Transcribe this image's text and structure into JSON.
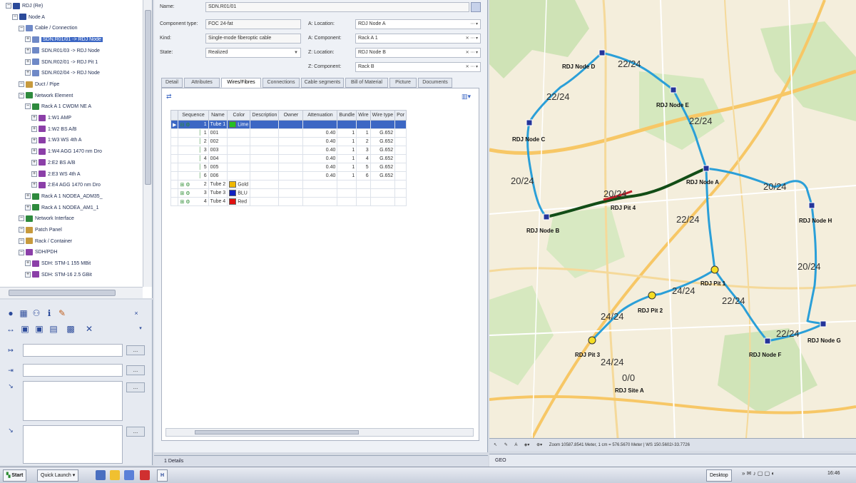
{
  "tree": {
    "items": [
      {
        "label": "RDJ (Re)",
        "icon": "house-icon"
      },
      {
        "label": "Node A",
        "icon": "house-icon"
      },
      {
        "label": "Cable / Connection",
        "icon": "cable-icon"
      },
      {
        "label": "SDN.R01/01 -> RDJ Node",
        "icon": "cable-icon"
      },
      {
        "label": "SDN.R01/03 -> RDJ Node",
        "icon": "cable-icon"
      },
      {
        "label": "SDN.R02/01 -> RDJ Pit 1",
        "icon": "cable-icon"
      },
      {
        "label": "SDN.R02/04 -> RDJ Node",
        "icon": "cable-icon"
      },
      {
        "label": "Duct / Pipe",
        "icon": "duct-icon"
      },
      {
        "label": "Network Element",
        "icon": "element-icon"
      },
      {
        "label": "Rack A 1 CWDM NE A",
        "icon": "element-icon"
      },
      {
        "label": "1:W1 AMP",
        "icon": "port-icon"
      },
      {
        "label": "1:W2 BS A/B",
        "icon": "port-icon"
      },
      {
        "label": "1:W3 WS 4th A",
        "icon": "port-icon"
      },
      {
        "label": "1:W4 AGG 1470 nm Dro",
        "icon": "port-icon"
      },
      {
        "label": "2:E2 BS A/B",
        "icon": "port-icon"
      },
      {
        "label": "2:E3 WS 4th A",
        "icon": "port-icon"
      },
      {
        "label": "2:E4 AGG 1470 nm Dro",
        "icon": "port-icon"
      },
      {
        "label": "Rack A 1 NODEA_ADM35_",
        "icon": "element-icon"
      },
      {
        "label": "Rack A 1 NODEA_AM1_1",
        "icon": "element-icon"
      },
      {
        "label": "Network Interface",
        "icon": "element-icon"
      },
      {
        "label": "Patch Panel",
        "icon": "folder-icon"
      },
      {
        "label": "Rack / Container",
        "icon": "folder-icon"
      },
      {
        "label": "SDH/PDH",
        "icon": "port-icon"
      },
      {
        "label": "SDH: STM-1 155 MBit",
        "icon": "port-icon"
      },
      {
        "label": "SDH: STM-16 2.5 GBit",
        "icon": "port-icon"
      }
    ]
  },
  "toolbox": {
    "row1": [
      "globe-icon",
      "grid-icon",
      "binoculars-icon",
      "info-icon",
      "pen-icon"
    ],
    "row2": [
      "double-arrow-icon",
      "disk-icon",
      "disk-icon",
      "save-all-icon",
      "props-icon",
      "delete-icon"
    ],
    "field_button_label": "..."
  },
  "form": {
    "name_label": "Name:",
    "name_value": "SDN.R01/01",
    "component_type_label": "Component type:",
    "component_type_value": "FOC 24-fat",
    "kind_label": "Kind:",
    "kind_value": "Single-mode fiberoptic cable",
    "state_label": "State:",
    "state_value": "Realized",
    "a_location_label": "A: Location:",
    "a_location_value": "RDJ Node A",
    "a_component_label": "A: Component:",
    "a_component_value": "Rack A 1",
    "z_location_label": "Z: Location:",
    "z_location_value": "RDJ Node B",
    "z_component_label": "Z: Component:",
    "z_component_value": "Rack B"
  },
  "tabs": [
    "Detail",
    "Attributes",
    "Wires/Fibres",
    "Connections",
    "Cable segments",
    "Bill of Material",
    "Picture",
    "Documents"
  ],
  "grid": {
    "headers": [
      "Sequence",
      "Name",
      "Color",
      "Description",
      "Owner",
      "Attenuation",
      "Bundle",
      "Wire",
      "Wire type",
      "Por"
    ],
    "rows": [
      {
        "seq": "1",
        "name": "Tube 1",
        "color": "Lime",
        "swatch": "#22c022",
        "att": "",
        "bundle": "",
        "wire": "",
        "wtype": "",
        "level": 0
      },
      {
        "seq": "1",
        "name": "001",
        "color": "",
        "swatch": "",
        "att": "0.40",
        "bundle": "1",
        "wire": "1",
        "wtype": "G.652",
        "level": 1
      },
      {
        "seq": "2",
        "name": "002",
        "color": "",
        "swatch": "",
        "att": "0.40",
        "bundle": "1",
        "wire": "2",
        "wtype": "G.652",
        "level": 1
      },
      {
        "seq": "3",
        "name": "003",
        "color": "",
        "swatch": "",
        "att": "0.40",
        "bundle": "1",
        "wire": "3",
        "wtype": "G.652",
        "level": 1
      },
      {
        "seq": "4",
        "name": "004",
        "color": "",
        "swatch": "",
        "att": "0.40",
        "bundle": "1",
        "wire": "4",
        "wtype": "G.652",
        "level": 1
      },
      {
        "seq": "5",
        "name": "005",
        "color": "",
        "swatch": "",
        "att": "0.40",
        "bundle": "1",
        "wire": "5",
        "wtype": "G.652",
        "level": 1
      },
      {
        "seq": "6",
        "name": "006",
        "color": "",
        "swatch": "",
        "att": "0.40",
        "bundle": "1",
        "wire": "6",
        "wtype": "G.652",
        "level": 1
      },
      {
        "seq": "2",
        "name": "Tube 2",
        "color": "Gold",
        "swatch": "#f0b800",
        "att": "",
        "bundle": "",
        "wire": "",
        "wtype": "",
        "level": 0
      },
      {
        "seq": "3",
        "name": "Tube 3",
        "color": "BLU",
        "swatch": "#1020c0",
        "att": "",
        "bundle": "",
        "wire": "",
        "wtype": "",
        "level": 0
      },
      {
        "seq": "4",
        "name": "Tube 4",
        "color": "Red",
        "swatch": "#e01010",
        "att": "",
        "bundle": "",
        "wire": "",
        "wtype": "",
        "level": 0
      }
    ]
  },
  "details_bar": "1 Details",
  "map": {
    "nodes": [
      {
        "label": "RDJ Node D",
        "kind": "node"
      },
      {
        "label": "RDJ Node E",
        "kind": "node"
      },
      {
        "label": "RDJ Node C",
        "kind": "node"
      },
      {
        "label": "RDJ Node A",
        "kind": "node"
      },
      {
        "label": "RDJ Node H",
        "kind": "node"
      },
      {
        "label": "RDJ Node B",
        "kind": "node"
      },
      {
        "label": "RDJ Pit 4",
        "kind": "pit"
      },
      {
        "label": "RDJ Pit 1",
        "kind": "pit"
      },
      {
        "label": "RDJ Pit 2",
        "kind": "pit"
      },
      {
        "label": "RDJ Pit 3",
        "kind": "pit"
      },
      {
        "label": "RDJ Node G",
        "kind": "node"
      },
      {
        "label": "RDJ Node F",
        "kind": "node"
      },
      {
        "label": "RDJ Site A",
        "kind": "site"
      }
    ],
    "fiber_labels": [
      "22/24",
      "22/24",
      "22/24",
      "20/24",
      "20/24",
      "20/24",
      "22/24",
      "20/24",
      "24/24",
      "22/24",
      "24/24",
      "22/24",
      "24/24",
      "0/0"
    ],
    "status_text": "Zoom 10587.8541 Meter, 1 cm = 576.5670 Meter | WS 150.5602/-33.7726",
    "tab_label": "GEO"
  },
  "taskbar": {
    "start_label": "Start",
    "quicklaunch_label": "Quick Launch",
    "app_label": "H",
    "desktop_label": "Desktop",
    "clock": "16:46"
  },
  "colors": {
    "selection": "#3c67c4",
    "route": "#2a9fd8",
    "route_highlight": "#124d16",
    "node": "#24349a",
    "pit": "#f5dd24"
  }
}
